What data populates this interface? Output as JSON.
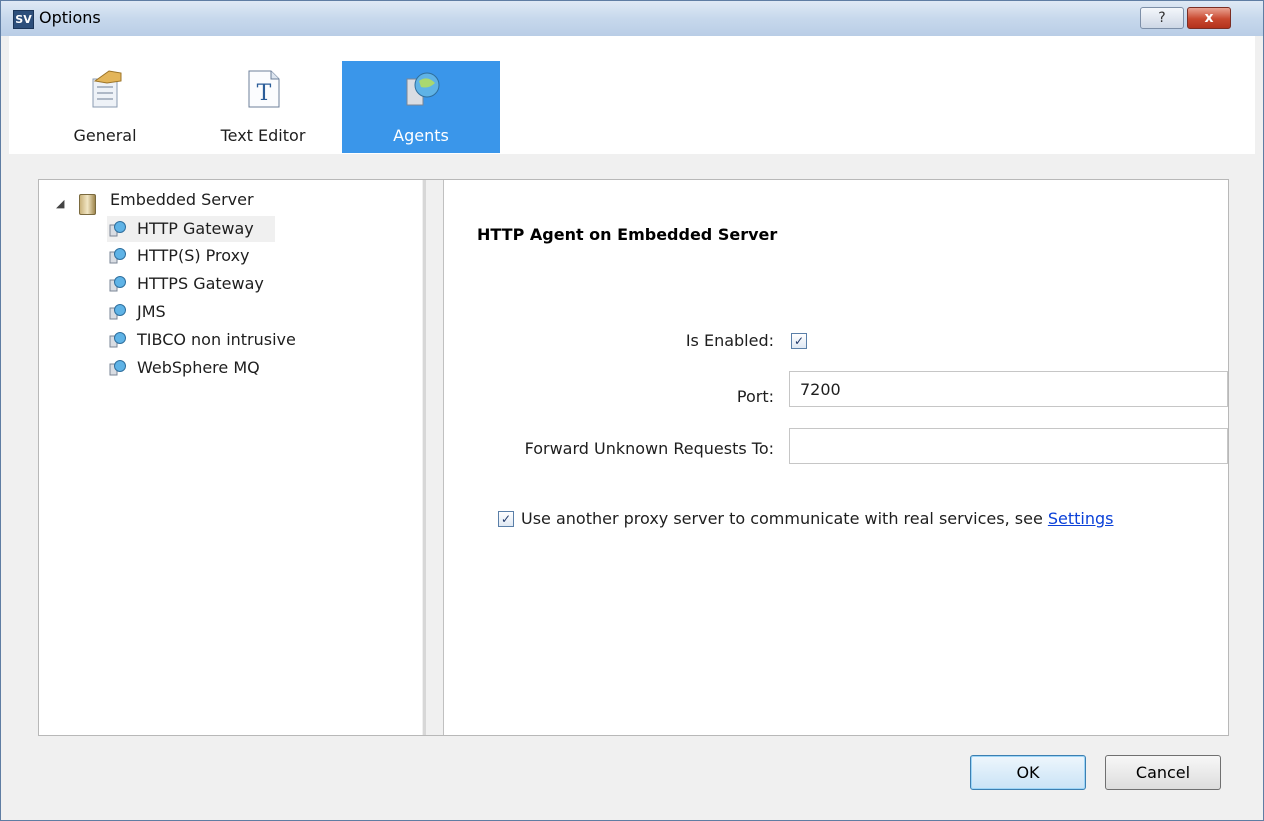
{
  "window": {
    "title": "Options",
    "app_icon": "SV",
    "help_label": "?",
    "close_label": "x"
  },
  "tabs": [
    {
      "label": "General",
      "icon": "general-settings-icon"
    },
    {
      "label": "Text Editor",
      "icon": "text-editor-icon"
    },
    {
      "label": "Agents",
      "icon": "agents-icon",
      "selected": true
    }
  ],
  "tree": {
    "root": "Embedded Server",
    "items": [
      "HTTP Gateway",
      "HTTP(S) Proxy",
      "HTTPS Gateway",
      "JMS",
      "TIBCO non intrusive",
      "WebSphere MQ"
    ],
    "selected": "HTTP Gateway"
  },
  "form": {
    "title": "HTTP Agent on Embedded Server",
    "is_enabled_label": "Is Enabled:",
    "is_enabled": true,
    "port_label": "Port:",
    "port_value": "7200",
    "forward_label": "Forward Unknown Requests To:",
    "forward_value": "",
    "proxy_checked": true,
    "proxy_text": "Use another proxy server to communicate with real services, see ",
    "proxy_link": "Settings"
  },
  "buttons": {
    "ok": "OK",
    "cancel": "Cancel"
  },
  "colors": {
    "selected_tab": "#3a96ea",
    "link": "#0b41d8"
  }
}
